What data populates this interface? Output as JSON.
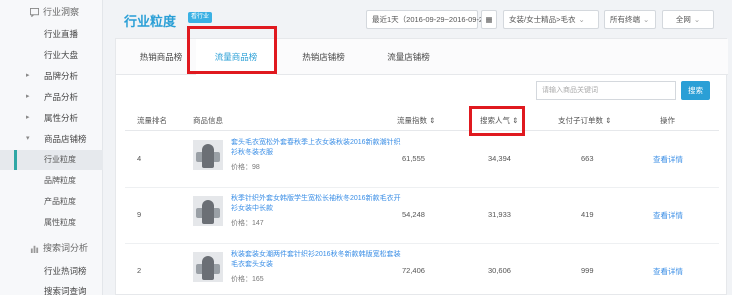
{
  "sidebar": {
    "section1": "行业洞察",
    "items": [
      {
        "label": "行业直播"
      },
      {
        "label": "行业大盘"
      },
      {
        "label": "品牌分析"
      },
      {
        "label": "产品分析"
      },
      {
        "label": "属性分析"
      },
      {
        "label": "商品店铺榜"
      }
    ],
    "subitems": [
      {
        "label": "行业粒度"
      },
      {
        "label": "品牌粒度"
      },
      {
        "label": "产品粒度"
      },
      {
        "label": "属性粒度"
      }
    ],
    "section2": "搜索词分析",
    "items2": [
      {
        "label": "行业热词榜"
      },
      {
        "label": "搜索词查询"
      }
    ]
  },
  "header": {
    "title": "行业粒度",
    "badge": "看行业",
    "date_range": "最近1天（2016-09-29~2016-09-29）",
    "category": "女装/女士精品>毛衣",
    "terminal": "所有终端",
    "network": "全网"
  },
  "tabs": [
    {
      "label": "热销商品榜"
    },
    {
      "label": "流量商品榜"
    },
    {
      "label": "热销店铺榜"
    },
    {
      "label": "流量店铺榜"
    }
  ],
  "search": {
    "placeholder": "请输入商品关键词",
    "button": "搜索"
  },
  "table": {
    "headers": [
      "流量排名",
      "商品信息",
      "流量指数 ⇕",
      "搜索人气 ⇕",
      "支付子订单数 ⇕",
      "操作"
    ],
    "rows": [
      {
        "rank": "4",
        "name": "套头毛衣宽松外套春秋季上衣女装秋装2016新款潮针织衫秋冬装衣服",
        "price": "价格：98",
        "traffic": "61,555",
        "search": "34,394",
        "orders": "663",
        "action": "查看详情"
      },
      {
        "rank": "9",
        "name": "秋季针织外套女韩版学生宽松长袖秋冬2016新款毛衣开衫女装中长款",
        "price": "价格：147",
        "traffic": "54,248",
        "search": "31,933",
        "orders": "419",
        "action": "查看详情"
      },
      {
        "rank": "2",
        "name": "秋装套装女潮两件套针织衫2016秋冬新款韩版宽松套装毛衣套头女装",
        "price": "价格：165",
        "traffic": "72,406",
        "search": "30,606",
        "orders": "999",
        "action": "查看详情"
      }
    ]
  },
  "colors": {
    "accent": "#2a9fd6",
    "highlight": "#e0191f",
    "active_bar": "#2fa7a5"
  }
}
